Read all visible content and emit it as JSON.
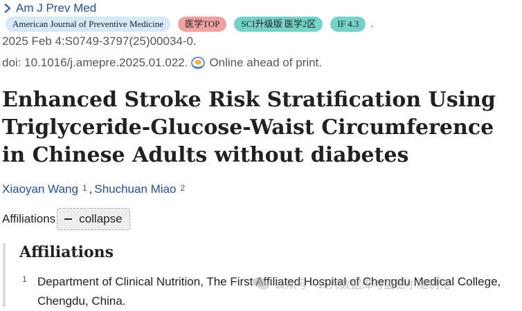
{
  "journal": {
    "name": "Am J Prev Med"
  },
  "badges": {
    "journal_full": "American Journal of Preventive Medicine",
    "top": "医学TOP",
    "sci": "SCI升级版 医学2区",
    "if": "IF 4.3",
    "trailing": "."
  },
  "citation": {
    "date_line": "2025 Feb 4:S0749-3797(25)00034-0.",
    "doi": "doi: 10.1016/j.amepre.2025.01.022.",
    "status": "Online ahead of print."
  },
  "article": {
    "title": "Enhanced Stroke Risk Stratification Using Triglyceride-Glucose-Waist Circumference in Chinese Adults without diabetes"
  },
  "authors": [
    {
      "name": "Xiaoyan Wang",
      "sup": "1"
    },
    {
      "name": "Shuchuan Miao",
      "sup": "2"
    }
  ],
  "author_sep": ",",
  "affiliations_toggle": {
    "label": "Affiliations",
    "button": "collapse"
  },
  "affiliations": {
    "heading": "Affiliations",
    "items": [
      {
        "num": "1",
        "text": "Department of Clinical Nutrition, The First Affiliated Hospital of Chengdu Medical College, Chengdu, China."
      }
    ]
  },
  "watermark": {
    "text": "公众号 · 公共数据库与孟德尔随机化"
  },
  "colors": {
    "link": "#1f4fa8",
    "badge_blue": "#d6e9f8",
    "badge_red": "#f3a0a0",
    "badge_teal": "#74d3c8"
  },
  "icons": [
    "chevron-right-icon",
    "online-print-icon",
    "wechat-icon",
    "minus-icon"
  ]
}
